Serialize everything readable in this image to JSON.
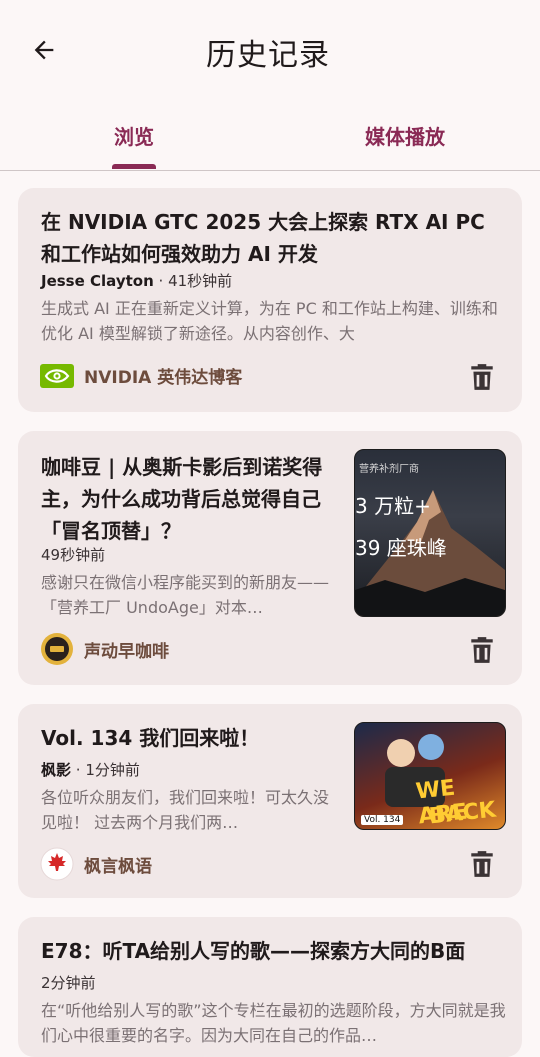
{
  "header": {
    "title": "历史记录"
  },
  "tabs": [
    {
      "label": "浏览"
    },
    {
      "label": "媒体播放"
    }
  ],
  "colors": {
    "accent": "#8a2a55",
    "card_bg": "#f1e8e8",
    "page_bg": "#fcf7f7",
    "source_text": "#6d4c3d"
  },
  "cards": [
    {
      "title": "在 NVIDIA GTC 2025 大会上探索 RTX AI PC 和工作站如何强效助力 AI 开发",
      "author": "Jesse Clayton",
      "time": "41秒钟前",
      "summary": "生成式 AI 正在重新定义计算，为在 PC 和工作站上构建、训练和优化 AI 模型解锁了新途径。从内容创作、大",
      "source": "NVIDIA 英伟达博客",
      "source_icon": "nvidia-logo-icon"
    },
    {
      "title": "咖啡豆 | 从奥斯卡影后到诺奖得主，为什么成功背后总觉得自己「冒名顶替」？",
      "time": "49秒钟前",
      "summary": "感谢只在微信小程序能买到的新朋友——「营养工厂 UndoAge」对本…",
      "source": "声动早咖啡",
      "thumb_text": [
        "营养补剂厂商",
        "3 万粒+",
        "39 座珠峰"
      ]
    },
    {
      "title": "Vol. 134 我们回来啦！",
      "author": "枫影",
      "time": "1分钟前",
      "summary": "各位听众朋友们，我们回来啦！可太久没见啦！ 过去两个月我们两…",
      "source": "枫言枫语",
      "thumb_text": [
        "WE ARE",
        "BACK",
        "Vol. 134"
      ]
    },
    {
      "title": "E78：听TA给别人写的歌——探索方大同的B面",
      "time": "2分钟前",
      "summary": "在“听他给别人写的歌”这个专栏在最初的选题阶段，方大同就是我们心中很重要的名字。因为大同在自己的作品…"
    }
  ]
}
